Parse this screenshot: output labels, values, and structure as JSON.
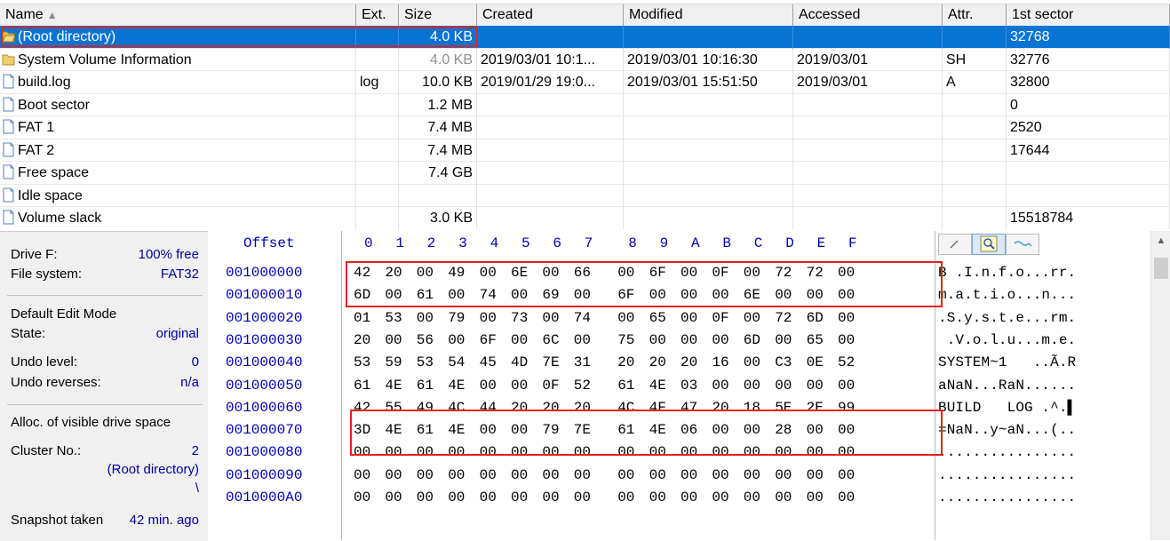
{
  "file_list": {
    "columns": [
      "Name",
      "Ext.",
      "Size",
      "Created",
      "Modified",
      "Accessed",
      "Attr.",
      "1st sector"
    ],
    "sort_indicator": "▲",
    "rows": [
      {
        "name": "(Root directory)",
        "ext": "",
        "size": "4.0 KB",
        "created": "",
        "modified": "",
        "accessed": "",
        "attr": "",
        "sector": "32768",
        "icon": "folder-open-icon"
      },
      {
        "name": "System Volume Information",
        "ext": "",
        "size": "4.0 KB",
        "created": "2019/03/01  10:1...",
        "modified": "2019/03/01  10:16:30",
        "accessed": "2019/03/01",
        "attr": "SH",
        "sector": "32776",
        "icon": "folder-icon"
      },
      {
        "name": "build.log",
        "ext": "log",
        "size": "10.0 KB",
        "created": "2019/01/29  19:0...",
        "modified": "2019/03/01  15:51:50",
        "accessed": "2019/03/01",
        "attr": "A",
        "sector": "32800",
        "icon": "file-icon"
      },
      {
        "name": "Boot sector",
        "ext": "",
        "size": "1.2 MB",
        "created": "",
        "modified": "",
        "accessed": "",
        "attr": "",
        "sector": "0",
        "icon": "file-icon"
      },
      {
        "name": "FAT 1",
        "ext": "",
        "size": "7.4 MB",
        "created": "",
        "modified": "",
        "accessed": "",
        "attr": "",
        "sector": "2520",
        "icon": "file-icon"
      },
      {
        "name": "FAT 2",
        "ext": "",
        "size": "7.4 MB",
        "created": "",
        "modified": "",
        "accessed": "",
        "attr": "",
        "sector": "17644",
        "icon": "file-icon"
      },
      {
        "name": "Free space",
        "ext": "",
        "size": "7.4 GB",
        "created": "",
        "modified": "",
        "accessed": "",
        "attr": "",
        "sector": "",
        "icon": "file-icon"
      },
      {
        "name": "Idle space",
        "ext": "",
        "size": "",
        "created": "",
        "modified": "",
        "accessed": "",
        "attr": "",
        "sector": "",
        "icon": "file-icon"
      },
      {
        "name": "Volume slack",
        "ext": "",
        "size": "3.0 KB",
        "created": "",
        "modified": "",
        "accessed": "",
        "attr": "",
        "sector": "15518784",
        "icon": "file-icon"
      }
    ]
  },
  "info": {
    "drive_label": "Drive F:",
    "drive_free": "100% free",
    "fs_label": "File system:",
    "fs_value": "FAT32",
    "edit_mode_label": "Default Edit Mode",
    "state_label": "State:",
    "state_value": "original",
    "undo_level_label": "Undo level:",
    "undo_level_value": "0",
    "undo_reverses_label": "Undo reverses:",
    "undo_reverses_value": "n/a",
    "alloc_label": "Alloc. of visible drive space",
    "cluster_label": "Cluster No.:",
    "cluster_value": "2",
    "cluster_name": "(Root directory)",
    "cluster_path": "\\",
    "snapshot_label": "Snapshot taken",
    "snapshot_value": "42 min. ago"
  },
  "hex": {
    "offset_header": "Offset",
    "columns": [
      "0",
      "1",
      "2",
      "3",
      "4",
      "5",
      "6",
      "7",
      "8",
      "9",
      "A",
      "B",
      "C",
      "D",
      "E",
      "F"
    ],
    "rows": [
      {
        "offset": "001000000",
        "bytes": [
          "42",
          "20",
          "00",
          "49",
          "00",
          "6E",
          "00",
          "66",
          "00",
          "6F",
          "00",
          "0F",
          "00",
          "72",
          "72",
          "00"
        ],
        "ascii": "B .I.n.f.o...rr."
      },
      {
        "offset": "001000010",
        "bytes": [
          "6D",
          "00",
          "61",
          "00",
          "74",
          "00",
          "69",
          "00",
          "6F",
          "00",
          "00",
          "00",
          "6E",
          "00",
          "00",
          "00"
        ],
        "ascii": "m.a.t.i.o...n..."
      },
      {
        "offset": "001000020",
        "bytes": [
          "01",
          "53",
          "00",
          "79",
          "00",
          "73",
          "00",
          "74",
          "00",
          "65",
          "00",
          "0F",
          "00",
          "72",
          "6D",
          "00"
        ],
        "ascii": ".S.y.s.t.e...rm."
      },
      {
        "offset": "001000030",
        "bytes": [
          "20",
          "00",
          "56",
          "00",
          "6F",
          "00",
          "6C",
          "00",
          "75",
          "00",
          "00",
          "00",
          "6D",
          "00",
          "65",
          "00"
        ],
        "ascii": " .V.o.l.u...m.e."
      },
      {
        "offset": "001000040",
        "bytes": [
          "53",
          "59",
          "53",
          "54",
          "45",
          "4D",
          "7E",
          "31",
          "20",
          "20",
          "20",
          "16",
          "00",
          "C3",
          "0E",
          "52"
        ],
        "ascii": "SYSTEM~1   ..Ã.R"
      },
      {
        "offset": "001000050",
        "bytes": [
          "61",
          "4E",
          "61",
          "4E",
          "00",
          "00",
          "0F",
          "52",
          "61",
          "4E",
          "03",
          "00",
          "00",
          "00",
          "00",
          "00"
        ],
        "ascii": "aNaN...RaN......"
      },
      {
        "offset": "001000060",
        "bytes": [
          "42",
          "55",
          "49",
          "4C",
          "44",
          "20",
          "20",
          "20",
          "4C",
          "4F",
          "47",
          "20",
          "18",
          "5E",
          "2E",
          "99"
        ],
        "ascii": "BUILD   LOG .^.▌"
      },
      {
        "offset": "001000070",
        "bytes": [
          "3D",
          "4E",
          "61",
          "4E",
          "00",
          "00",
          "79",
          "7E",
          "61",
          "4E",
          "06",
          "00",
          "00",
          "28",
          "00",
          "00"
        ],
        "ascii": "=NaN..y~aN...(.."
      },
      {
        "offset": "001000080",
        "bytes": [
          "00",
          "00",
          "00",
          "00",
          "00",
          "00",
          "00",
          "00",
          "00",
          "00",
          "00",
          "00",
          "00",
          "00",
          "00",
          "00"
        ],
        "ascii": "................"
      },
      {
        "offset": "001000090",
        "bytes": [
          "00",
          "00",
          "00",
          "00",
          "00",
          "00",
          "00",
          "00",
          "00",
          "00",
          "00",
          "00",
          "00",
          "00",
          "00",
          "00"
        ],
        "ascii": "................"
      },
      {
        "offset": "0010000A0",
        "bytes": [
          "00",
          "00",
          "00",
          "00",
          "00",
          "00",
          "00",
          "00",
          "00",
          "00",
          "00",
          "00",
          "00",
          "00",
          "00",
          "00"
        ],
        "ascii": "................"
      }
    ]
  },
  "colors": {
    "selection": "#0a74d4",
    "highlight": "#e2231a",
    "offset_text": "#0000b8"
  }
}
